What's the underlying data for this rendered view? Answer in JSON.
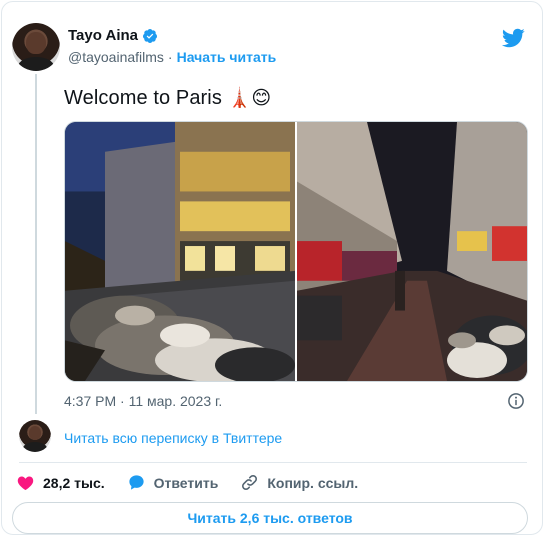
{
  "author": {
    "display_name": "Tayo Aina",
    "handle": "@tayoainafilms",
    "separator": "·",
    "follow_label": "Начать читать",
    "verified_icon": "verified-badge-icon"
  },
  "brand": {
    "icon": "twitter-bird-icon",
    "color": "#1d9bf0"
  },
  "tweet": {
    "text": "Welcome to Paris",
    "emojis": "🗼😊",
    "media": [
      {
        "name": "paris-street-photo-1",
        "description_icon": "photo"
      },
      {
        "name": "paris-street-photo-2",
        "description_icon": "photo"
      }
    ],
    "timestamp": "4:37 PM · 11 мар. 2023 г."
  },
  "thread": {
    "label": "Читать всю переписку в Твиттере"
  },
  "actions": {
    "likes_count": "28,2 тыс.",
    "reply_label": "Ответить",
    "copy_link_label": "Копир. ссыл."
  },
  "replies_button": {
    "label": "Читать 2,6 тыс. ответов"
  },
  "colors": {
    "accent": "#1d9bf0",
    "like": "#f91880",
    "secondary_text": "#536471",
    "border": "#cfd9de"
  }
}
